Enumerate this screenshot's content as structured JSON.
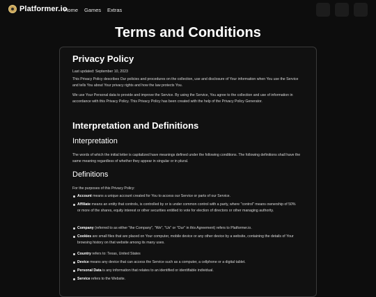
{
  "nav": {
    "brand": "Platformer.io",
    "links": [
      "Home",
      "Games",
      "Extras"
    ]
  },
  "page": {
    "title": "Terms and Conditions"
  },
  "policy": {
    "heading": "Privacy Policy",
    "updated": "Last updated: September 10, 2023",
    "intro_1": "This Privacy Policy describes Our policies and procedures on the collection, use and disclosure of Your information when You use the Service and tells You about Your privacy rights and how the law protects You.",
    "intro_2": "We use Your Personal data to provide and improve the Service. By using the Service, You agree to the collection and use of information in accordance with this Privacy Policy. This Privacy Policy has been created with the help of the Privacy Policy Generator.",
    "section_heading": "Interpretation and Definitions",
    "interp_heading": "Interpretation",
    "interp_text": "The words of which the initial letter is capitalized have meanings defined under the following conditions. The following definitions shall have the same meaning regardless of whether they appear in singular or in plural.",
    "defs_heading": "Definitions",
    "defs_intro": "For the purposes of this Privacy Policy:",
    "definitions": [
      {
        "term": "Account",
        "text": " means a unique account created for You to access our Service or parts of our Service."
      },
      {
        "term": "Affiliate",
        "text": " means an entity that controls, is controlled by or is under common control with a party, where \"control\" means ownership of 50% or more of the shares, equity interest or other securities entitled to vote for election of directors or other managing authority."
      },
      {
        "term": "Company",
        "text": " (referred to as either \"the Company\", \"We\", \"Us\" or \"Our\" in this Agreement) refers to Platformer.io."
      },
      {
        "term": "Cookies",
        "text": " are small files that are placed on Your computer, mobile device or any other device by a website, containing the details of Your browsing history on that website among its many uses."
      },
      {
        "term": "Country",
        "text": " refers to: Texas, United States"
      },
      {
        "term": "Device",
        "text": " means any device that can access the Service such as a computer, a cellphone or a digital tablet."
      },
      {
        "term": "Personal Data",
        "text": " is any information that relates to an identified or identifiable individual."
      },
      {
        "term": "Service",
        "text": " refers to the Website."
      }
    ]
  }
}
